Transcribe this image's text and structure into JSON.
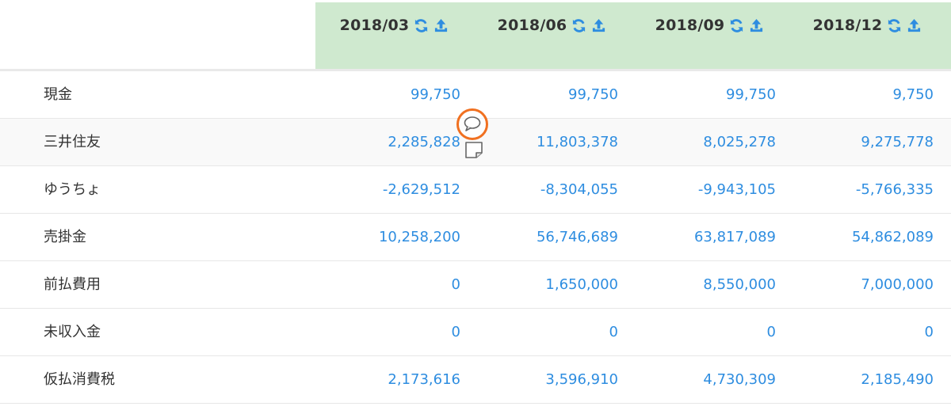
{
  "colors": {
    "header_bg": "#cfe9cf",
    "value_text": "#2e8de0",
    "marker": "#f07020"
  },
  "columns": [
    {
      "period": "2018/03"
    },
    {
      "period": "2018/06"
    },
    {
      "period": "2018/09"
    },
    {
      "period": "2018/12"
    }
  ],
  "header_icons": [
    "refresh-icon",
    "upload-icon"
  ],
  "rows": [
    {
      "label": "現金",
      "values": [
        "99,750",
        "99,750",
        "99,750",
        "9,750"
      ]
    },
    {
      "label": "三井住友",
      "values": [
        "2,285,828",
        "11,803,378",
        "8,025,278",
        "9,275,778"
      ]
    },
    {
      "label": "ゆうちょ",
      "values": [
        "-2,629,512",
        "-8,304,055",
        "-9,943,105",
        "-5,766,335"
      ]
    },
    {
      "label": "売掛金",
      "values": [
        "10,258,200",
        "56,746,689",
        "63,817,089",
        "54,862,089"
      ]
    },
    {
      "label": "前払費用",
      "values": [
        "0",
        "1,650,000",
        "8,550,000",
        "7,000,000"
      ]
    },
    {
      "label": "未収入金",
      "values": [
        "0",
        "0",
        "0",
        "0"
      ]
    },
    {
      "label": "仮払消費税",
      "values": [
        "2,173,616",
        "3,596,910",
        "4,730,309",
        "2,185,490"
      ]
    }
  ]
}
